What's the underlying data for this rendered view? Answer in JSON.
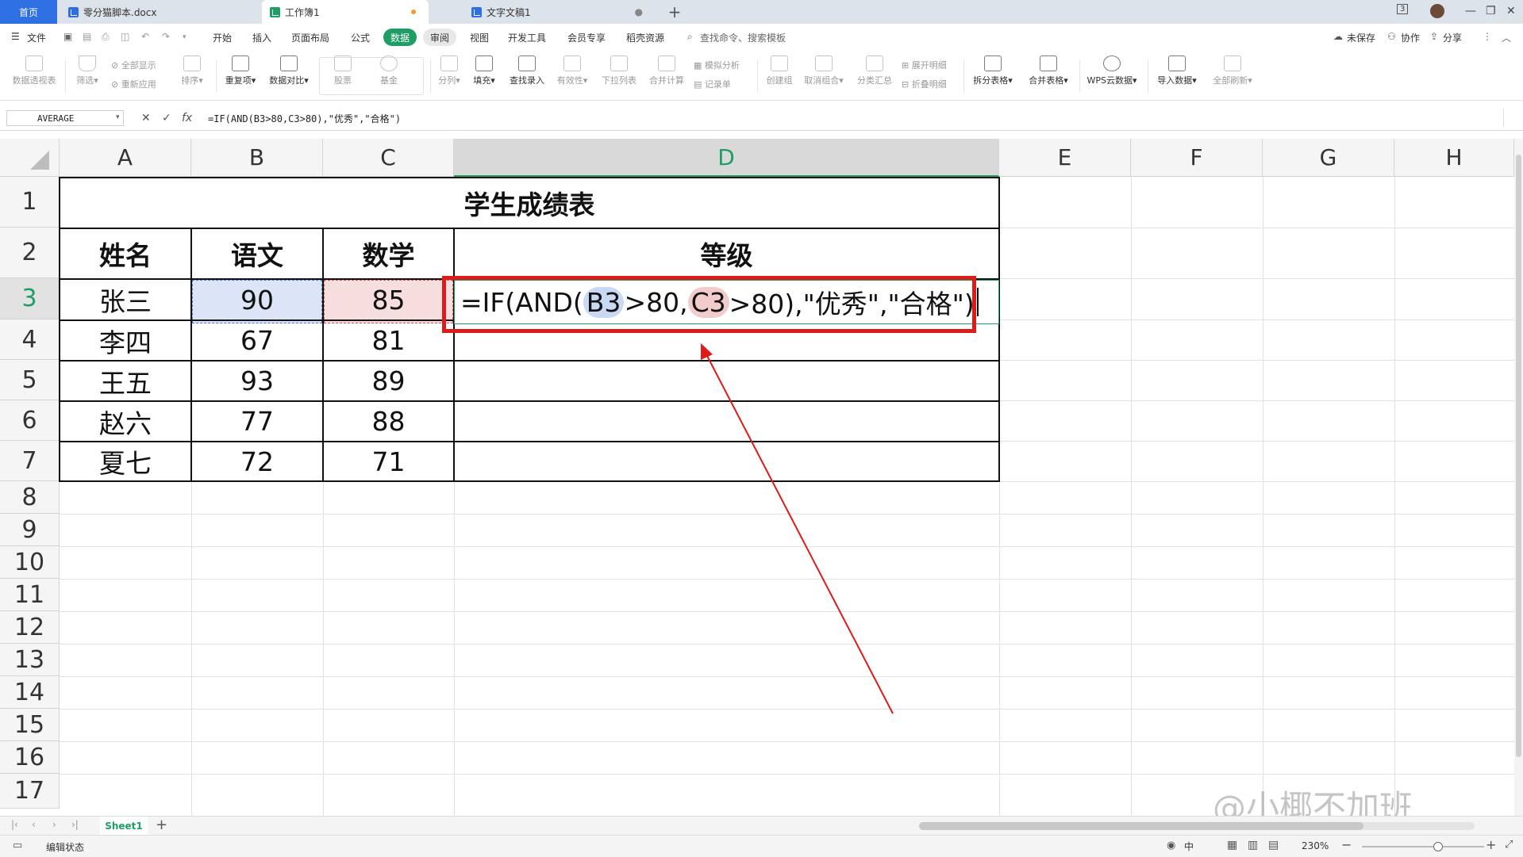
{
  "tabs": {
    "home": "首页",
    "doc1": "零分猫脚本.docx",
    "workbook": "工作簿1",
    "doc2": "文字文稿1",
    "window_badge": "3"
  },
  "menu": {
    "file": "文件",
    "items": [
      "开始",
      "插入",
      "页面布局",
      "公式",
      "数据",
      "审阅",
      "视图",
      "开发工具",
      "会员专享",
      "稻壳资源"
    ],
    "active": "数据",
    "search": "查找命令、搜索模板",
    "unsaved": "未保存",
    "collab": "协作",
    "share": "分享"
  },
  "ribbon": {
    "pivot": "数据透视表",
    "filter": "筛选",
    "show_all": "全部显示",
    "reapply": "重新应用",
    "sort": "排序",
    "duplicates": "重复项",
    "compare": "数据对比",
    "stocks": "股票",
    "funds": "基金",
    "split": "分列",
    "fill": "填充",
    "lookup": "查找录入",
    "validity": "有效性",
    "dropdown": "下拉列表",
    "consolidate": "合并计算",
    "simulate": "模拟分析",
    "record": "记录单",
    "group": "创建组",
    "ungroup": "取消组合",
    "subtotal": "分类汇总",
    "expand": "展开明细",
    "collapse": "折叠明细",
    "split_table": "拆分表格",
    "merge_table": "合并表格",
    "cloud": "WPS云数据",
    "import": "导入数据",
    "refresh": "全部刷新"
  },
  "formula_bar": {
    "name_box": "AVERAGE",
    "formula": "=IF(AND(B3>80,C3>80),\"优秀\",\"合格\")"
  },
  "columns": [
    "A",
    "B",
    "C",
    "D",
    "E",
    "F",
    "G",
    "H"
  ],
  "active_column": "D",
  "rows": [
    "1",
    "2",
    "3",
    "4",
    "5",
    "6",
    "7",
    "8",
    "9",
    "10",
    "11",
    "12",
    "13",
    "14",
    "15",
    "16",
    "17"
  ],
  "active_row": "3",
  "table": {
    "title": "学生成绩表",
    "headers": [
      "姓名",
      "语文",
      "数学",
      "等级"
    ],
    "students": [
      {
        "name": "张三",
        "chinese": "90",
        "math": "85"
      },
      {
        "name": "李四",
        "chinese": "67",
        "math": "81"
      },
      {
        "name": "王五",
        "chinese": "93",
        "math": "89"
      },
      {
        "name": "赵六",
        "chinese": "77",
        "math": "88"
      },
      {
        "name": "夏七",
        "chinese": "72",
        "math": "71"
      }
    ]
  },
  "edit": {
    "part1": "=IF(AND(",
    "ref1": "B3",
    "part2": ">80,",
    "ref2": "C3",
    "part3": ">80),\"优秀\",\"合格\")"
  },
  "sheets": {
    "active": "Sheet1",
    "add": "+"
  },
  "status": {
    "mode": "编辑状态",
    "zoom": "230%",
    "input": "中"
  },
  "watermark": "@小椰不加班",
  "colors": {
    "accent_green": "#1e9e64",
    "highlight_red": "#e01919",
    "ref_blue": "#c9d8f3",
    "ref_red": "#f2cccc"
  }
}
